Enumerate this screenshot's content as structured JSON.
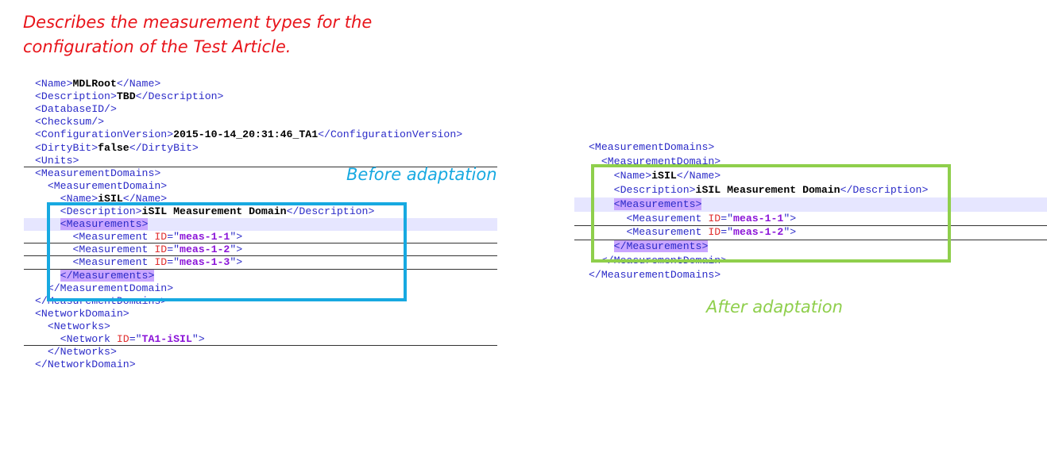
{
  "caption": {
    "line1": "Describes the measurement types  for the",
    "line2": "configuration of the Test Article."
  },
  "before": {
    "label": "Before adaptation",
    "lines": [
      [
        {
          "t": "<Name>",
          "c": "tag"
        },
        {
          "t": "MDLRoot",
          "c": "txt"
        },
        {
          "t": "</Name>",
          "c": "tag"
        }
      ],
      [
        {
          "t": "<Description>",
          "c": "tag"
        },
        {
          "t": "TBD",
          "c": "txt"
        },
        {
          "t": "</Description>",
          "c": "tag"
        }
      ],
      [
        {
          "t": "<DatabaseID/>",
          "c": "tag"
        }
      ],
      [
        {
          "t": "<Checksum/>",
          "c": "tag"
        }
      ],
      [
        {
          "t": "<ConfigurationVersion>",
          "c": "tag"
        },
        {
          "t": "2015-10-14_20:31:46_TA1",
          "c": "txt"
        },
        {
          "t": "</ConfigurationVersion>",
          "c": "tag"
        }
      ],
      [
        {
          "t": "<DirtyBit>",
          "c": "tag"
        },
        {
          "t": "false",
          "c": "txt"
        },
        {
          "t": "</DirtyBit>",
          "c": "tag"
        }
      ],
      [
        {
          "t": "<Units>",
          "c": "tag"
        }
      ],
      [
        {
          "t": "<MeasurementDomains>",
          "c": "tag"
        }
      ],
      [
        {
          "t": "  <MeasurementDomain>",
          "c": "tag"
        }
      ],
      [
        {
          "t": "    <Name>",
          "c": "tag"
        },
        {
          "t": "iSIL",
          "c": "txt"
        },
        {
          "t": "</Name>",
          "c": "tag"
        }
      ],
      [
        {
          "t": "    <Description>",
          "c": "tag"
        },
        {
          "t": "iSIL Measurement Domain",
          "c": "txt"
        },
        {
          "t": "</Description>",
          "c": "tag"
        }
      ],
      [
        {
          "t": "    ",
          "c": "tag"
        },
        {
          "t": "<Measurements>",
          "c": "hl"
        }
      ],
      [
        {
          "t": "      <Measurement ",
          "c": "tag"
        },
        {
          "t": "ID",
          "c": "attr"
        },
        {
          "t": "=\"",
          "c": "tag"
        },
        {
          "t": "meas-1-1",
          "c": "val"
        },
        {
          "t": "\">",
          "c": "tag"
        }
      ],
      [
        {
          "t": "      <Measurement ",
          "c": "tag"
        },
        {
          "t": "ID",
          "c": "attr"
        },
        {
          "t": "=\"",
          "c": "tag"
        },
        {
          "t": "meas-1-2",
          "c": "val"
        },
        {
          "t": "\">",
          "c": "tag"
        }
      ],
      [
        {
          "t": "      <Measurement ",
          "c": "tag"
        },
        {
          "t": "ID",
          "c": "attr"
        },
        {
          "t": "=\"",
          "c": "tag"
        },
        {
          "t": "meas-1-3",
          "c": "val"
        },
        {
          "t": "\">",
          "c": "tag"
        }
      ],
      [
        {
          "t": "    ",
          "c": "tag"
        },
        {
          "t": "</Measurements>",
          "c": "hl"
        }
      ],
      [
        {
          "t": "  </MeasurementDomain>",
          "c": "tag"
        }
      ],
      [
        {
          "t": "</MeasurementDomains>",
          "c": "tag"
        }
      ],
      [
        {
          "t": "<NetworkDomain>",
          "c": "tag"
        }
      ],
      [
        {
          "t": "  <Networks>",
          "c": "tag"
        }
      ],
      [
        {
          "t": "    <Network ",
          "c": "tag"
        },
        {
          "t": "ID",
          "c": "attr"
        },
        {
          "t": "=\"",
          "c": "tag"
        },
        {
          "t": "TA1-iSIL",
          "c": "val"
        },
        {
          "t": "\">",
          "c": "tag"
        }
      ],
      [
        {
          "t": "  </Networks>",
          "c": "tag"
        }
      ],
      [
        {
          "t": "</NetworkDomain>",
          "c": "tag"
        }
      ]
    ]
  },
  "after": {
    "label": "After adaptation",
    "lines": [
      [
        {
          "t": "<MeasurementDomains>",
          "c": "tag"
        }
      ],
      [
        {
          "t": "  <MeasurementDomain>",
          "c": "tag"
        }
      ],
      [
        {
          "t": "    <Name>",
          "c": "tag"
        },
        {
          "t": "iSIL",
          "c": "txt"
        },
        {
          "t": "</Name>",
          "c": "tag"
        }
      ],
      [
        {
          "t": "    <Description>",
          "c": "tag"
        },
        {
          "t": "iSIL Measurement Domain",
          "c": "txt"
        },
        {
          "t": "</Description>",
          "c": "tag"
        }
      ],
      [
        {
          "t": "    ",
          "c": "tag"
        },
        {
          "t": "<Measurements>",
          "c": "hl"
        }
      ],
      [
        {
          "t": "      <Measurement ",
          "c": "tag"
        },
        {
          "t": "ID",
          "c": "attr"
        },
        {
          "t": "=\"",
          "c": "tag"
        },
        {
          "t": "meas-1-1",
          "c": "val"
        },
        {
          "t": "\">",
          "c": "tag"
        }
      ],
      [
        {
          "t": "      <Measurement ",
          "c": "tag"
        },
        {
          "t": "ID",
          "c": "attr"
        },
        {
          "t": "=\"",
          "c": "tag"
        },
        {
          "t": "meas-1-2",
          "c": "val"
        },
        {
          "t": "\">",
          "c": "tag"
        }
      ],
      [
        {
          "t": "    ",
          "c": "tag"
        },
        {
          "t": "</Measurements>",
          "c": "hl"
        }
      ],
      [
        {
          "t": "  </MeasurementDomain>",
          "c": "tag"
        }
      ],
      [
        {
          "t": "</MeasurementDomains>",
          "c": "tag"
        }
      ]
    ]
  },
  "colors": {
    "caption": "#e8141a",
    "before_box": "#17a9e1",
    "after_box": "#8fcf4c",
    "tag": "#2b2bc8",
    "highlight": "#c9a6ff"
  }
}
